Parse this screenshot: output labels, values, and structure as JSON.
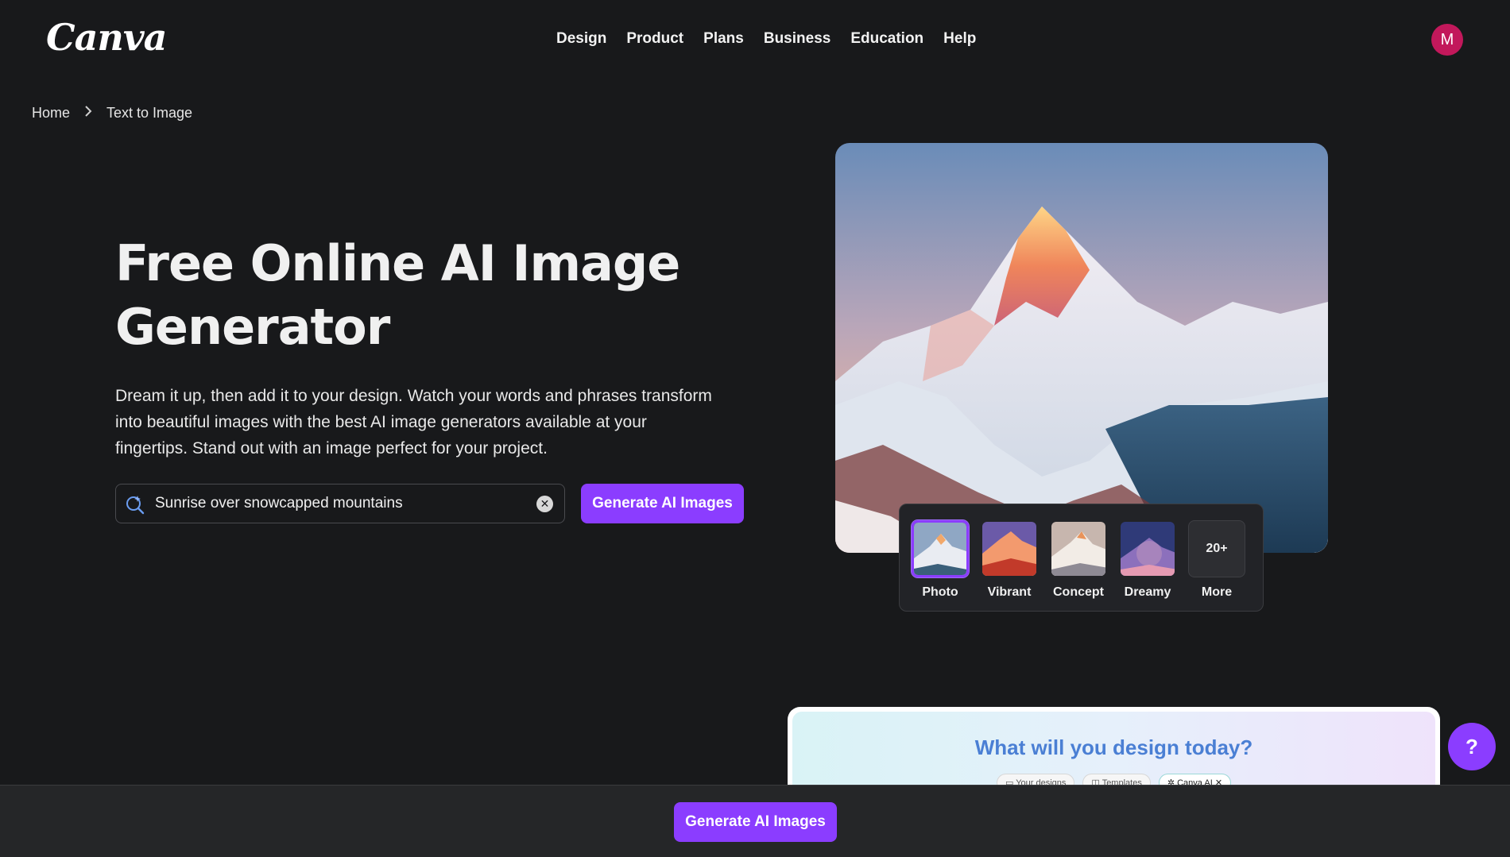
{
  "brand": {
    "logo_text": "Canva"
  },
  "nav": {
    "items": [
      "Design",
      "Product",
      "Plans",
      "Business",
      "Education",
      "Help"
    ]
  },
  "user": {
    "avatar_initial": "M",
    "avatar_color": "#c2185b"
  },
  "breadcrumb": {
    "home": "Home",
    "current": "Text to Image"
  },
  "hero": {
    "title_line1": "Free Online AI Image",
    "title_line2": "Generator",
    "description_line1": "Dream it up, then add it to your design. Watch your words and phrases transform",
    "description_line2": "into beautiful images with the best AI image generators available at your",
    "description_line3": "fingertips. Stand out with an image perfect for your project."
  },
  "search": {
    "value": "Sunrise over snowcapped mountains",
    "icon": "magic-search-icon",
    "clear_icon": "clear-icon"
  },
  "generate_button": {
    "label": "Generate AI Images",
    "color": "#8b3dff"
  },
  "styles": {
    "selected": "Photo",
    "options": [
      {
        "label": "Photo"
      },
      {
        "label": "Vibrant"
      },
      {
        "label": "Concept"
      },
      {
        "label": "Dreamy"
      }
    ],
    "more": {
      "count": "20+",
      "label": "More"
    }
  },
  "preview": {
    "title": "What will you design today?",
    "pills": [
      "Your designs",
      "Templates",
      "Canva AI"
    ]
  },
  "help": {
    "label": "?"
  },
  "bottom_bar": {
    "button_label": "Generate AI Images"
  }
}
